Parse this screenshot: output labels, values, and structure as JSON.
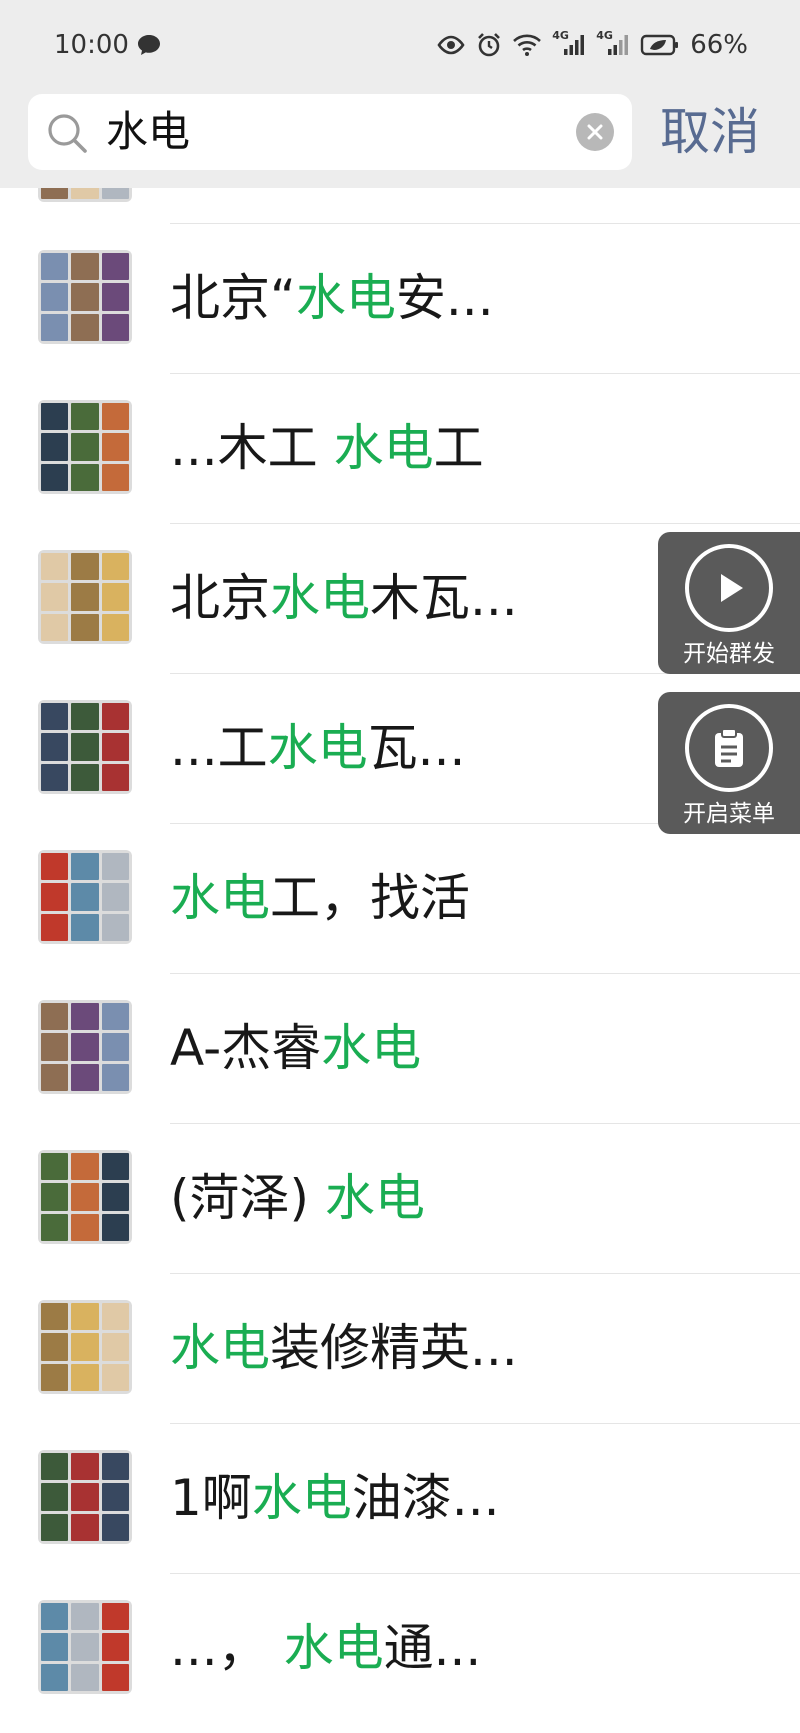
{
  "status_bar": {
    "time": "10:00",
    "network_a": "4G",
    "network_b": "4G",
    "battery": "66%"
  },
  "search": {
    "query": "水电",
    "cancel_label": "取消"
  },
  "results": [
    {
      "pre": "北京“",
      "hl": "水电",
      "post": "安..."
    },
    {
      "pre": "...木工 ",
      "hl": "水电",
      "post": "工"
    },
    {
      "pre": "北京",
      "hl": "水电",
      "post": "木瓦..."
    },
    {
      "pre": "...工",
      "hl": "水电",
      "post": "瓦..."
    },
    {
      "pre": "",
      "hl": "水电",
      "post": "工，找活"
    },
    {
      "pre": "A-杰睿",
      "hl": "水电",
      "post": ""
    },
    {
      "pre": "(菏泽) ",
      "hl": "水电",
      "post": ""
    },
    {
      "pre": "",
      "hl": "水电",
      "post": "装修精英..."
    },
    {
      "pre": "1啊",
      "hl": "水电",
      "post": "油漆..."
    },
    {
      "pre": "...， ",
      "hl": "水电",
      "post": "通..."
    }
  ],
  "floating_buttons": {
    "start_broadcast": "开始群发",
    "open_menu": "开启菜单"
  },
  "colors": {
    "highlight": "#1aad52",
    "cancel": "#586b91",
    "header_bg": "#ededed"
  }
}
